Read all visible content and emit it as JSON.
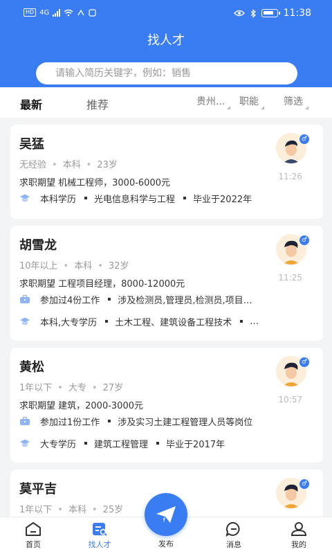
{
  "status_bar": {
    "hd": "HD",
    "network": "4G",
    "time": "11:38"
  },
  "header": {
    "title": "找人才",
    "search_placeholder": "请输入简历关键字，例如：销售"
  },
  "tabs": {
    "newest": "最新",
    "recommend": "推荐"
  },
  "filters": {
    "city": "贵州...",
    "job": "职能",
    "filter": "筛选"
  },
  "candidates": [
    {
      "name": "吴猛",
      "experience": "无经验",
      "education": "本科",
      "age": "23岁",
      "expectation": "求职期望 机械工程师，3000-6000元",
      "time": "11:26",
      "edu_line": [
        "本科学历",
        "光电信息科学与工程",
        "毕业于2022年"
      ]
    },
    {
      "name": "胡雪龙",
      "experience": "10年以上",
      "education": "本科",
      "age": "32岁",
      "expectation": "求职期望 工程项目经理，8000-12000元",
      "time": "11:25",
      "work_line": [
        "参加过4份工作",
        "涉及检测员,管理员,检测员,项目…"
      ],
      "edu_line": [
        "本科,大专学历",
        "土木工程、建筑设备工程技术",
        "…"
      ]
    },
    {
      "name": "黄松",
      "experience": "1年以下",
      "education": "大专",
      "age": "27岁",
      "expectation": "求职期望 建筑，2000-3000元",
      "time": "10:57",
      "work_line": [
        "参加过1份工作",
        "涉及实习土建工程管理人员等岗位"
      ],
      "edu_line": [
        "大专学历",
        "建筑工程管理",
        "毕业于2017年"
      ]
    },
    {
      "name": "莫平吉",
      "experience": "1年以下",
      "education": "本科",
      "age": "25岁"
    }
  ],
  "nav": {
    "home": "首页",
    "find": "找人才",
    "post": "发布",
    "messages": "消息",
    "mine": "我的"
  },
  "colors": {
    "accent": "#3a7df2",
    "background": "#f3f4f6"
  }
}
